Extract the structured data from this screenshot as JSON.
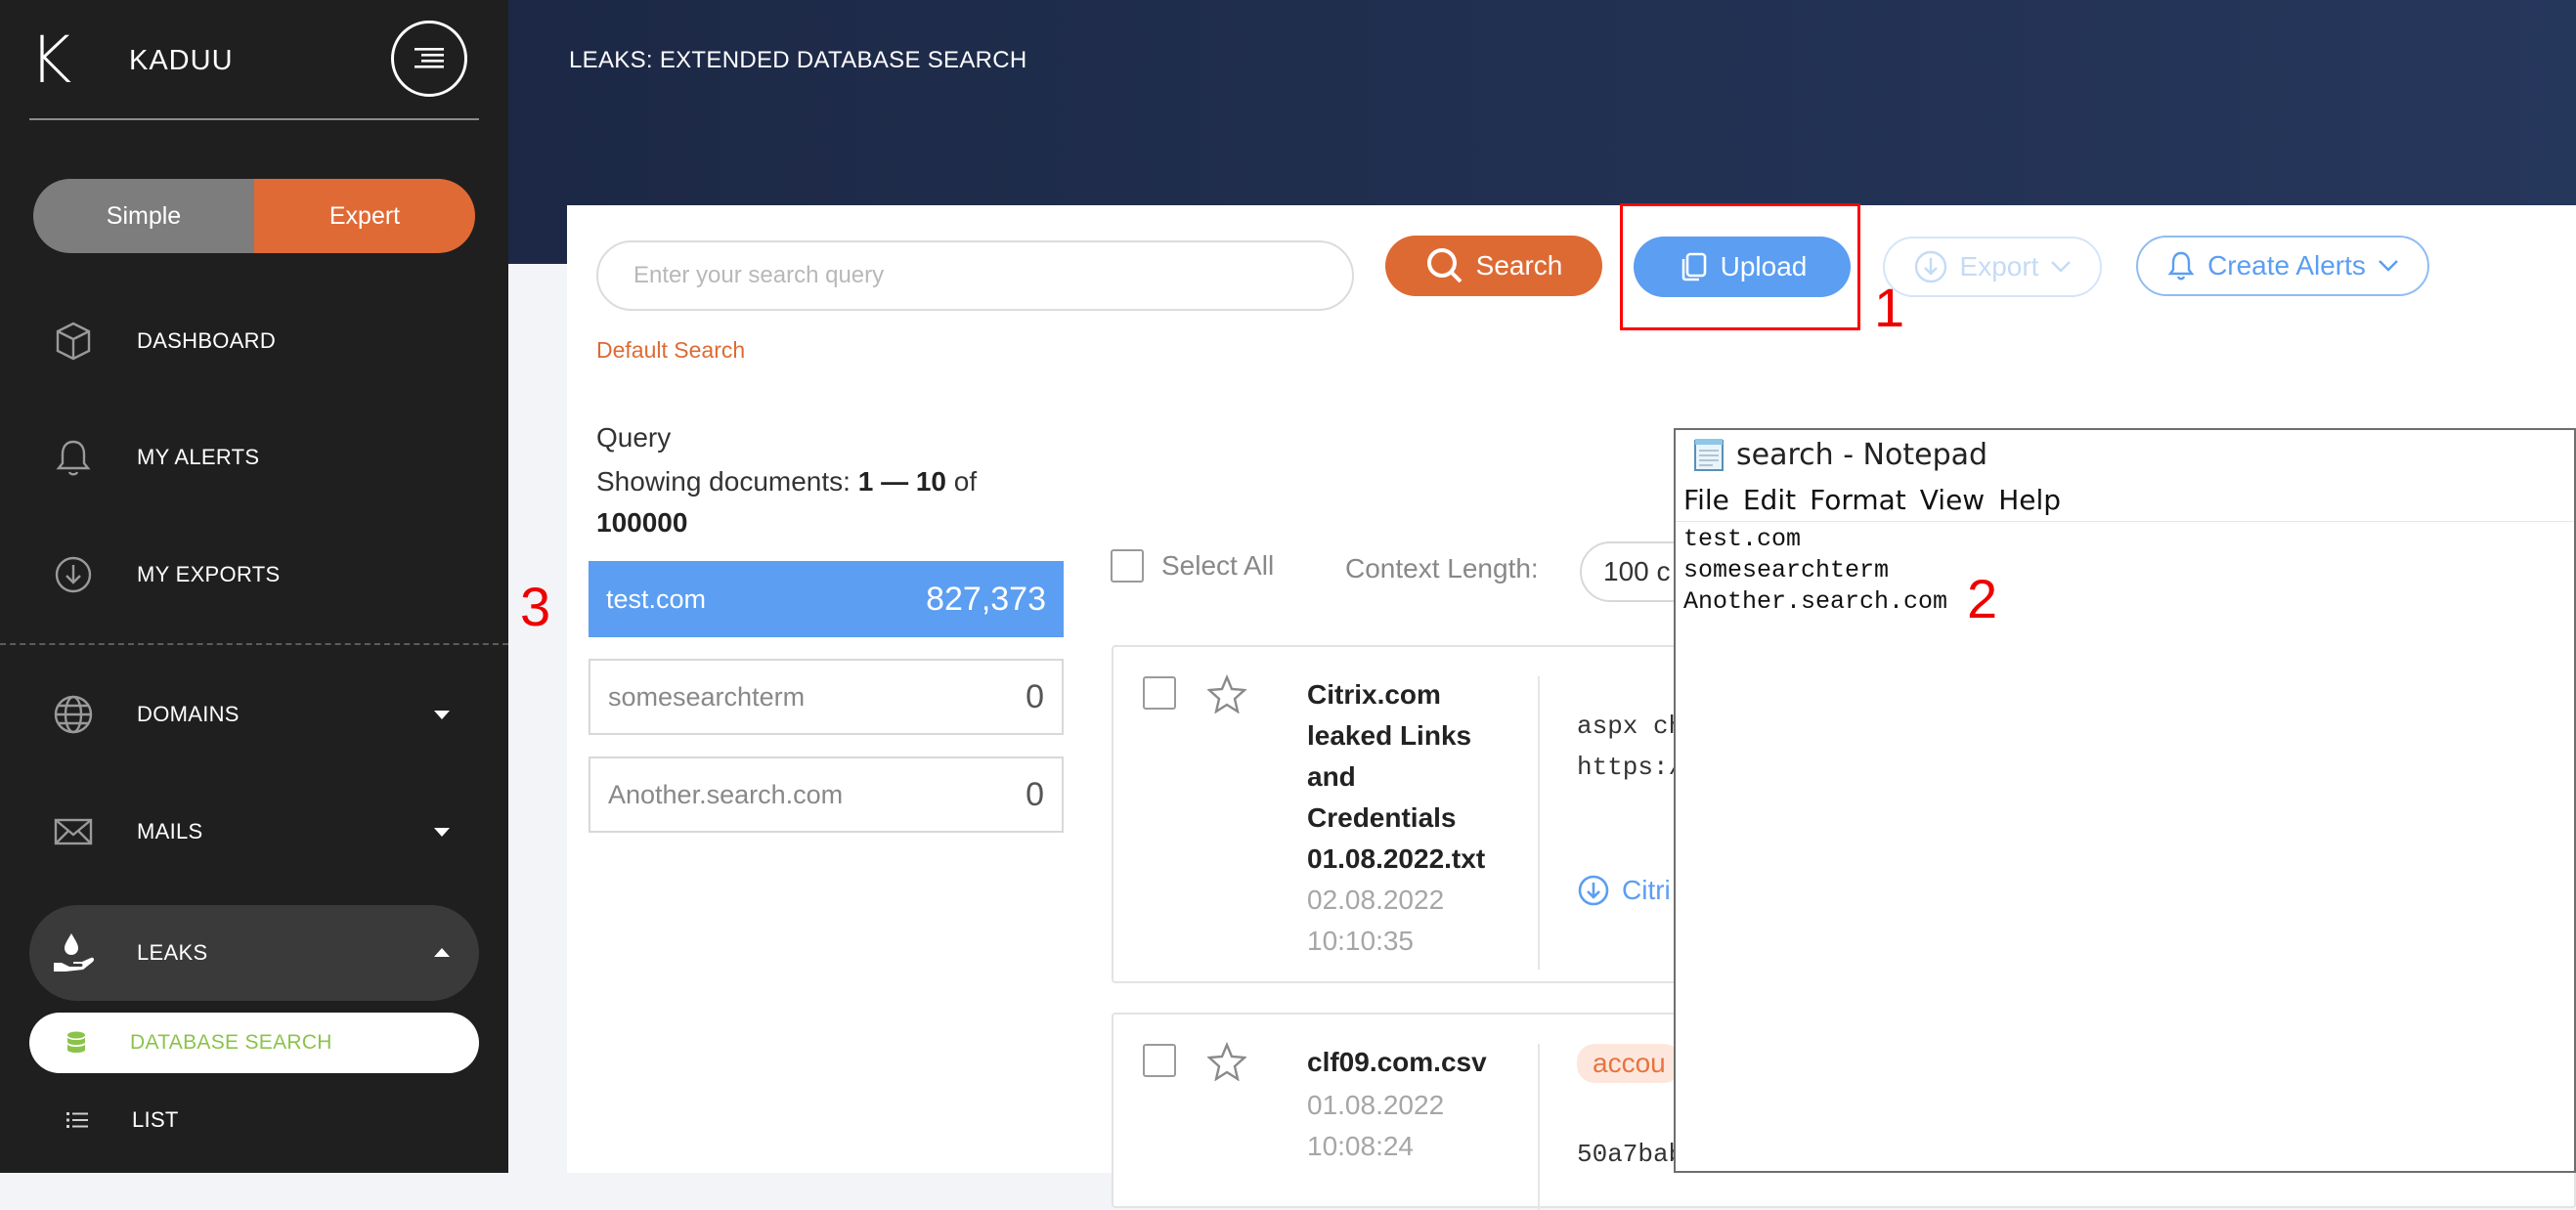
{
  "brand": {
    "logo": "K",
    "name": "KADUU"
  },
  "mode_toggle": {
    "simple": "Simple",
    "expert": "Expert",
    "active": "Expert"
  },
  "nav": {
    "dashboard": "DASHBOARD",
    "alerts": "MY ALERTS",
    "exports": "MY EXPORTS",
    "domains": "DOMAINS",
    "mails": "MAILS",
    "leaks": "LEAKS",
    "database_search": "DATABASE SEARCH",
    "list": "LIST"
  },
  "header": {
    "title": "LEAKS: EXTENDED DATABASE SEARCH"
  },
  "search": {
    "placeholder": "Enter your search query",
    "search_label": "Search",
    "upload_label": "Upload",
    "export_label": "Export",
    "alerts_label": "Create Alerts",
    "default_search": "Default Search"
  },
  "query": {
    "title": "Query",
    "showing_prefix": "Showing documents: ",
    "range": "1 — 10",
    "of": " of",
    "total": "100000",
    "items": [
      {
        "term": "test.com",
        "count": "827,373"
      },
      {
        "term": "somesearchterm",
        "count": "0"
      },
      {
        "term": "Another.search.com",
        "count": "0"
      }
    ]
  },
  "results_toolbar": {
    "select_all": "Select All",
    "context_label": "Context Length:",
    "context_value": "100 c"
  },
  "results": [
    {
      "title": "Citrix.com leaked Links and Credentials 01.08.2022.txt",
      "date": "02.08.2022",
      "time": "10:10:35",
      "snippet_line1": "aspx ch",
      "snippet_line2": "https:/",
      "link": "Citri"
    },
    {
      "title": "clf09.com.csv",
      "date": "01.08.2022",
      "time": "10:08:24",
      "tag": "accou",
      "snippet_line1": "50a7bab"
    }
  ],
  "notepad": {
    "title": "search - Notepad",
    "menu": [
      "File",
      "Edit",
      "Format",
      "View",
      "Help"
    ],
    "lines": [
      "test.com",
      "somesearchterm",
      "Another.search.com"
    ]
  },
  "annotations": {
    "one": "1",
    "two": "2",
    "three": "3"
  },
  "colors": {
    "sidebar": "#1f1f1f",
    "accent_orange": "#de6a33",
    "accent_blue": "#5b9ef2",
    "header_navy": "#1c2845",
    "annotation_red": "#ff0000"
  }
}
